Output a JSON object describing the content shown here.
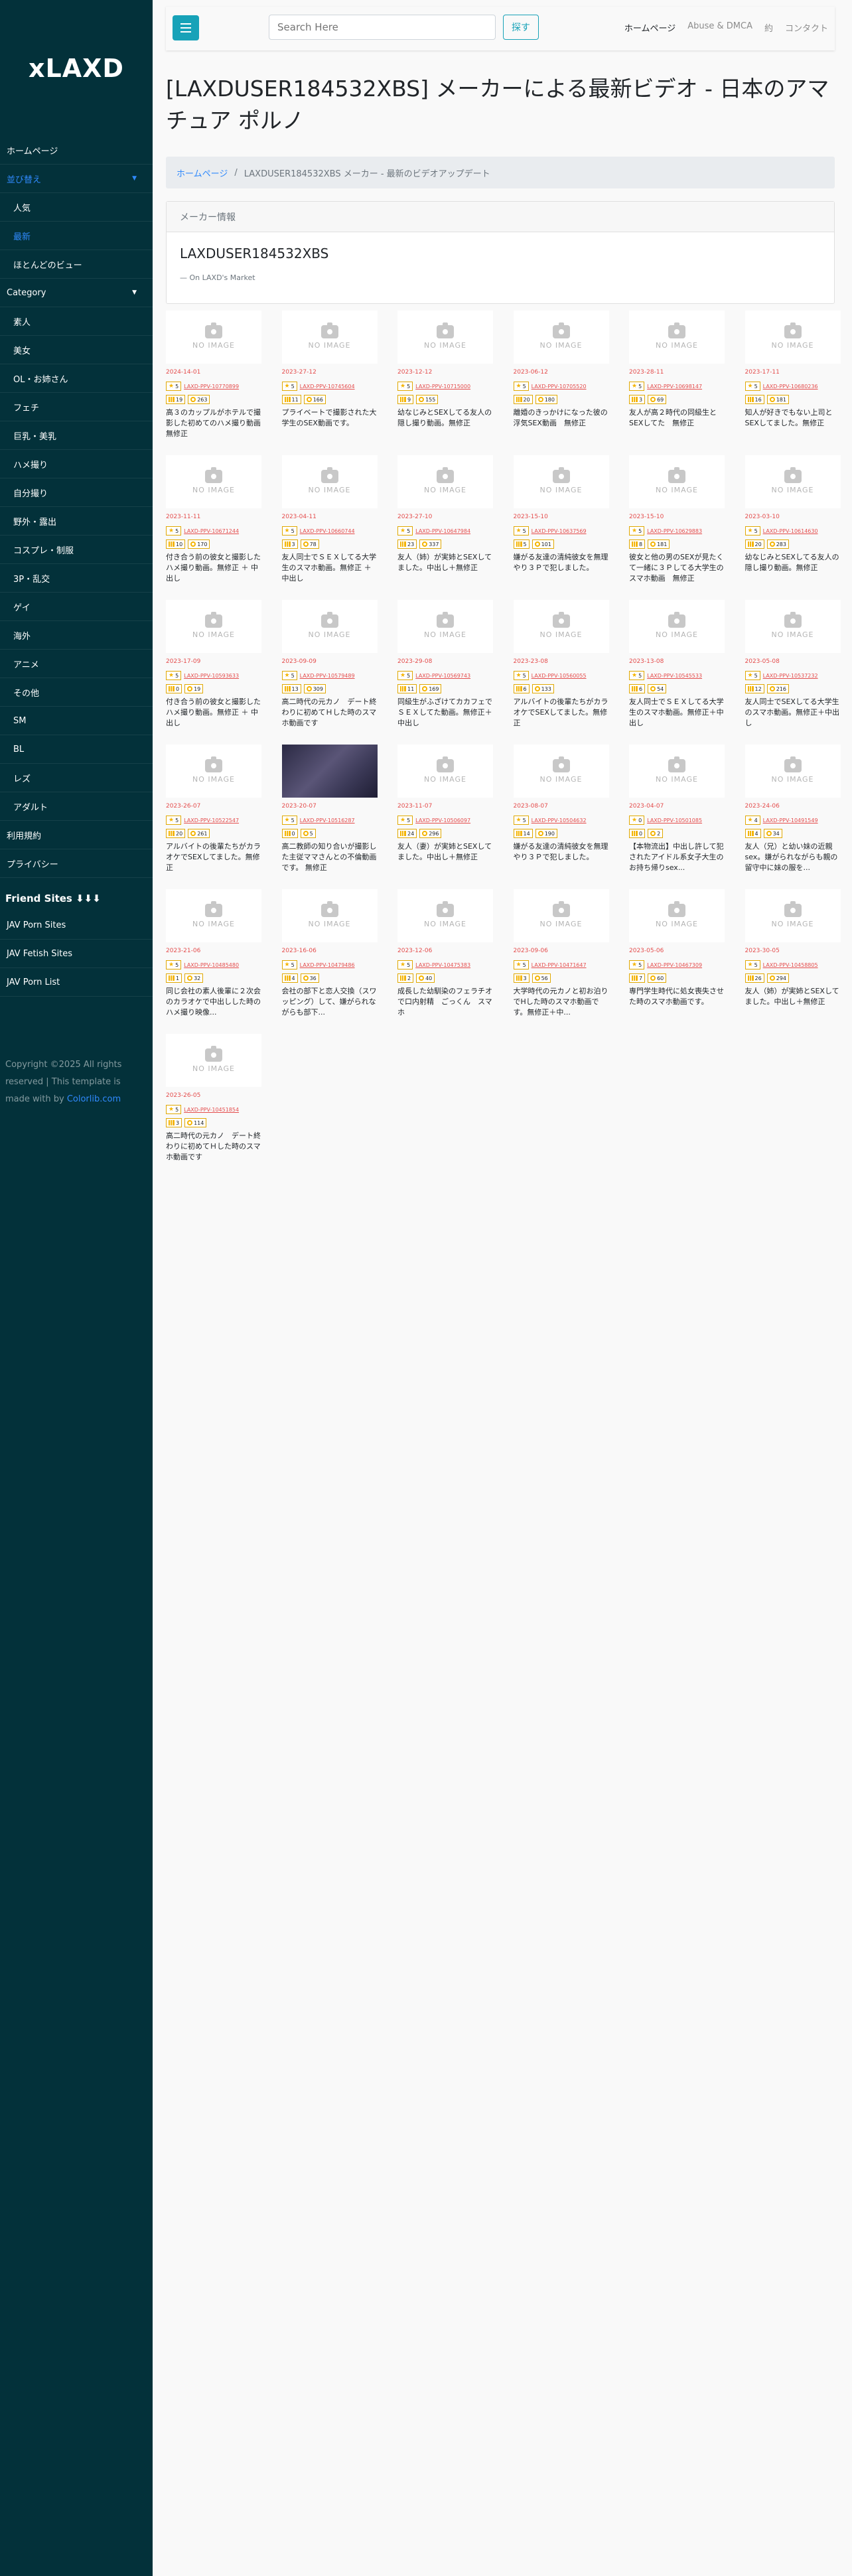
{
  "sidebar": {
    "logo": "xLAXD",
    "items": [
      {
        "label": "ホームページ",
        "active": false,
        "sub": false,
        "caret": false
      },
      {
        "label": "並び替え",
        "active": true,
        "sub": false,
        "caret": true
      },
      {
        "label": "人気",
        "active": false,
        "sub": true,
        "caret": false
      },
      {
        "label": "最新",
        "active": true,
        "sub": true,
        "caret": false
      },
      {
        "label": "ほとんどのビュー",
        "active": false,
        "sub": true,
        "caret": false
      },
      {
        "label": "Category",
        "active": false,
        "sub": false,
        "caret": true
      },
      {
        "label": "素人",
        "active": false,
        "sub": true,
        "caret": false
      },
      {
        "label": "美女",
        "active": false,
        "sub": true,
        "caret": false
      },
      {
        "label": "OL・お姉さん",
        "active": false,
        "sub": true,
        "caret": false
      },
      {
        "label": "フェチ",
        "active": false,
        "sub": true,
        "caret": false
      },
      {
        "label": "巨乳・美乳",
        "active": false,
        "sub": true,
        "caret": false
      },
      {
        "label": "ハメ撮り",
        "active": false,
        "sub": true,
        "caret": false
      },
      {
        "label": "自分撮り",
        "active": false,
        "sub": true,
        "caret": false
      },
      {
        "label": "野外・露出",
        "active": false,
        "sub": true,
        "caret": false
      },
      {
        "label": "コスプレ・制服",
        "active": false,
        "sub": true,
        "caret": false
      },
      {
        "label": "3P・乱交",
        "active": false,
        "sub": true,
        "caret": false
      },
      {
        "label": "ゲイ",
        "active": false,
        "sub": true,
        "caret": false
      },
      {
        "label": "海外",
        "active": false,
        "sub": true,
        "caret": false
      },
      {
        "label": "アニメ",
        "active": false,
        "sub": true,
        "caret": false
      },
      {
        "label": "その他",
        "active": false,
        "sub": true,
        "caret": false
      },
      {
        "label": "SM",
        "active": false,
        "sub": true,
        "caret": false
      },
      {
        "label": "BL",
        "active": false,
        "sub": true,
        "caret": false
      },
      {
        "label": "レズ",
        "active": false,
        "sub": true,
        "caret": false
      },
      {
        "label": "アダルト",
        "active": false,
        "sub": true,
        "caret": false
      },
      {
        "label": "利用規約",
        "active": false,
        "sub": false,
        "caret": false
      },
      {
        "label": "プライバシー",
        "active": false,
        "sub": false,
        "caret": false
      }
    ],
    "friend_title": "Friend Sites ⬇⬇⬇",
    "friend_items": [
      "JAV Porn Sites",
      "JAV Fetish Sites",
      "JAV Porn List"
    ],
    "copyright": "Copyright ©2025 All rights reserved | This template is made with by ",
    "copyright_link": "Colorlib.com"
  },
  "header": {
    "search_placeholder": "Search Here",
    "search_button": "探す",
    "links": [
      {
        "label": "ホームページ",
        "current": true
      },
      {
        "label": "Abuse & DMCA",
        "current": false
      },
      {
        "label": "約",
        "current": false
      },
      {
        "label": "コンタクト",
        "current": false
      }
    ]
  },
  "page": {
    "title": "[LAXDUSER184532XBS] メーカーによる最新ビデオ - 日本のアマチュア ポルノ",
    "breadcrumb_home": "ホームページ",
    "breadcrumb_current": "LAXDUSER184532XBS メーカー - 最新のビデオアップデート",
    "maker_header": "メーカー情報",
    "maker_name": "LAXDUSER184532XBS",
    "maker_source": "— On LAXD's Market"
  },
  "no_image_text": "NO IMAGE",
  "videos": [
    {
      "date": "2024-14-01",
      "rating": "5",
      "id": "LAXD-PPV-10770899",
      "likes": "19",
      "coins": "263",
      "title": "高３のカップルがホテルで撮影した初めてのハメ撮り動画　無修正",
      "dark": false
    },
    {
      "date": "2023-27-12",
      "rating": "5",
      "id": "LAXD-PPV-10745604",
      "likes": "11",
      "coins": "166",
      "title": "プライベートで撮影された大学生のSEX動画です。",
      "dark": false
    },
    {
      "date": "2023-12-12",
      "rating": "5",
      "id": "LAXD-PPV-10715000",
      "likes": "9",
      "coins": "155",
      "title": "幼なじみとSEXしてる友人の隠し撮り動画。無修正",
      "dark": false
    },
    {
      "date": "2023-06-12",
      "rating": "5",
      "id": "LAXD-PPV-10705520",
      "likes": "20",
      "coins": "180",
      "title": "離婚のきっかけになった彼の浮気SEX動画　無修正",
      "dark": false
    },
    {
      "date": "2023-28-11",
      "rating": "5",
      "id": "LAXD-PPV-10698147",
      "likes": "3",
      "coins": "69",
      "title": "友人が高２時代の同級生とSEXしてた　無修正",
      "dark": false
    },
    {
      "date": "2023-17-11",
      "rating": "5",
      "id": "LAXD-PPV-10680236",
      "likes": "16",
      "coins": "181",
      "title": "知人が好きでもない上司とSEXしてました。無修正",
      "dark": false
    },
    {
      "date": "2023-11-11",
      "rating": "5",
      "id": "LAXD-PPV-10671244",
      "likes": "10",
      "coins": "170",
      "title": "付き合う前の彼女と撮影したハメ撮り動画。無修正 ＋ 中出し",
      "dark": false
    },
    {
      "date": "2023-04-11",
      "rating": "5",
      "id": "LAXD-PPV-10660744",
      "likes": "3",
      "coins": "78",
      "title": "友人同士でＳＥＸしてる大学生のスマホ動画。無修正 ＋ 中出し",
      "dark": false
    },
    {
      "date": "2023-27-10",
      "rating": "5",
      "id": "LAXD-PPV-10647984",
      "likes": "23",
      "coins": "337",
      "title": "友人（姉）が実姉とSEXしてました。中出し＋無修正",
      "dark": false
    },
    {
      "date": "2023-15-10",
      "rating": "5",
      "id": "LAXD-PPV-10637569",
      "likes": "5",
      "coins": "101",
      "title": "嫌がる友達の清純彼女を無理やり３Ｐで犯しました。",
      "dark": false
    },
    {
      "date": "2023-15-10",
      "rating": "5",
      "id": "LAXD-PPV-10629883",
      "likes": "8",
      "coins": "181",
      "title": "彼女と他の男のSEXが見たくて一緒に３Ｐしてる大学生のスマホ動画　無修正",
      "dark": false
    },
    {
      "date": "2023-03-10",
      "rating": "5",
      "id": "LAXD-PPV-10614630",
      "likes": "20",
      "coins": "283",
      "title": "幼なじみとSEXしてる友人の隠し撮り動画。無修正",
      "dark": false
    },
    {
      "date": "2023-17-09",
      "rating": "5",
      "id": "LAXD-PPV-10593633",
      "likes": "0",
      "coins": "19",
      "title": "付き合う前の彼女と撮影したハメ撮り動画。無修正 ＋ 中出し",
      "dark": false
    },
    {
      "date": "2023-09-09",
      "rating": "5",
      "id": "LAXD-PPV-10579489",
      "likes": "13",
      "coins": "309",
      "title": "高二時代の元カノ　デート終わりに初めてＨした時のスマホ動画です",
      "dark": false
    },
    {
      "date": "2023-29-08",
      "rating": "5",
      "id": "LAXD-PPV-10569743",
      "likes": "11",
      "coins": "169",
      "title": "同級生がふざけてカカフェでＳＥＸしてた動画。無修正＋中出し",
      "dark": false
    },
    {
      "date": "2023-23-08",
      "rating": "5",
      "id": "LAXD-PPV-10560055",
      "likes": "6",
      "coins": "133",
      "title": "アルバイトの後輩たちがカラオケでSEXしてました。無修正",
      "dark": false
    },
    {
      "date": "2023-13-08",
      "rating": "5",
      "id": "LAXD-PPV-10545533",
      "likes": "6",
      "coins": "54",
      "title": "友人同士でＳＥＸしてる大学生のスマホ動画。無修正＋中出し",
      "dark": false
    },
    {
      "date": "2023-05-08",
      "rating": "5",
      "id": "LAXD-PPV-10537232",
      "likes": "12",
      "coins": "216",
      "title": "友人同士でSEXしてる大学生のスマホ動画。無修正＋中出し",
      "dark": false
    },
    {
      "date": "2023-26-07",
      "rating": "5",
      "id": "LAXD-PPV-10522547",
      "likes": "20",
      "coins": "261",
      "title": "アルバイトの後輩たちがカラオケでSEXしてました。無修正",
      "dark": false
    },
    {
      "date": "2023-20-07",
      "rating": "5",
      "id": "LAXD-PPV-10516287",
      "likes": "0",
      "coins": "5",
      "title": "高二教師の知り合いが撮影した主従ママさんとの不倫動画です。 無修正",
      "dark": true
    },
    {
      "date": "2023-11-07",
      "rating": "5",
      "id": "LAXD-PPV-10506097",
      "likes": "24",
      "coins": "296",
      "title": "友人（妻）が実姉とSEXしてました。中出し＋無修正",
      "dark": false
    },
    {
      "date": "2023-08-07",
      "rating": "5",
      "id": "LAXD-PPV-10504632",
      "likes": "14",
      "coins": "190",
      "title": "嫌がる友達の清純彼女を無理やり３Ｐで犯しました。",
      "dark": false
    },
    {
      "date": "2023-04-07",
      "rating": "0",
      "id": "LAXD-PPV-10501085",
      "likes": "0",
      "coins": "2",
      "title": "【本物流出】中出し許して犯されたアイドル系女子大生のお持ち帰りsex...",
      "dark": false
    },
    {
      "date": "2023-24-06",
      "rating": "4",
      "id": "LAXD-PPV-10491549",
      "likes": "4",
      "coins": "34",
      "title": "友人（兄）と幼い妹の近親sex。嫌がられながらも親の留守中に妹の服を...",
      "dark": false
    },
    {
      "date": "2023-21-06",
      "rating": "5",
      "id": "LAXD-PPV-10485480",
      "likes": "1",
      "coins": "32",
      "title": "同じ会社の素人後輩に２次会のカラオケで中出しした時のハメ撮り映像...",
      "dark": false
    },
    {
      "date": "2023-16-06",
      "rating": "5",
      "id": "LAXD-PPV-10479486",
      "likes": "4",
      "coins": "36",
      "title": "会社の部下と恋人交換（スワッピング）して、嫌がられながらも部下...",
      "dark": false
    },
    {
      "date": "2023-12-06",
      "rating": "5",
      "id": "LAXD-PPV-10475383",
      "likes": "2",
      "coins": "40",
      "title": "成長した幼馴染のフェラチオで口内射精　ごっくん　スマホ",
      "dark": false
    },
    {
      "date": "2023-09-06",
      "rating": "5",
      "id": "LAXD-PPV-10471647",
      "likes": "3",
      "coins": "56",
      "title": "大学時代の元カノと初お泊りでHした時のスマホ動画です。無修正＋中...",
      "dark": false
    },
    {
      "date": "2023-05-06",
      "rating": "5",
      "id": "LAXD-PPV-10467309",
      "likes": "7",
      "coins": "60",
      "title": "専門学生時代に処女喪失させた時のスマホ動画です。",
      "dark": false
    },
    {
      "date": "2023-30-05",
      "rating": "5",
      "id": "LAXD-PPV-10458805",
      "likes": "26",
      "coins": "294",
      "title": "友人（姉）が実姉とSEXしてました。中出し＋無修正",
      "dark": false
    },
    {
      "date": "2023-26-05",
      "rating": "5",
      "id": "LAXD-PPV-10451854",
      "likes": "3",
      "coins": "114",
      "title": "高二時代の元カノ　デート終わりに初めてＨした時のスマホ動画です",
      "dark": false
    }
  ]
}
